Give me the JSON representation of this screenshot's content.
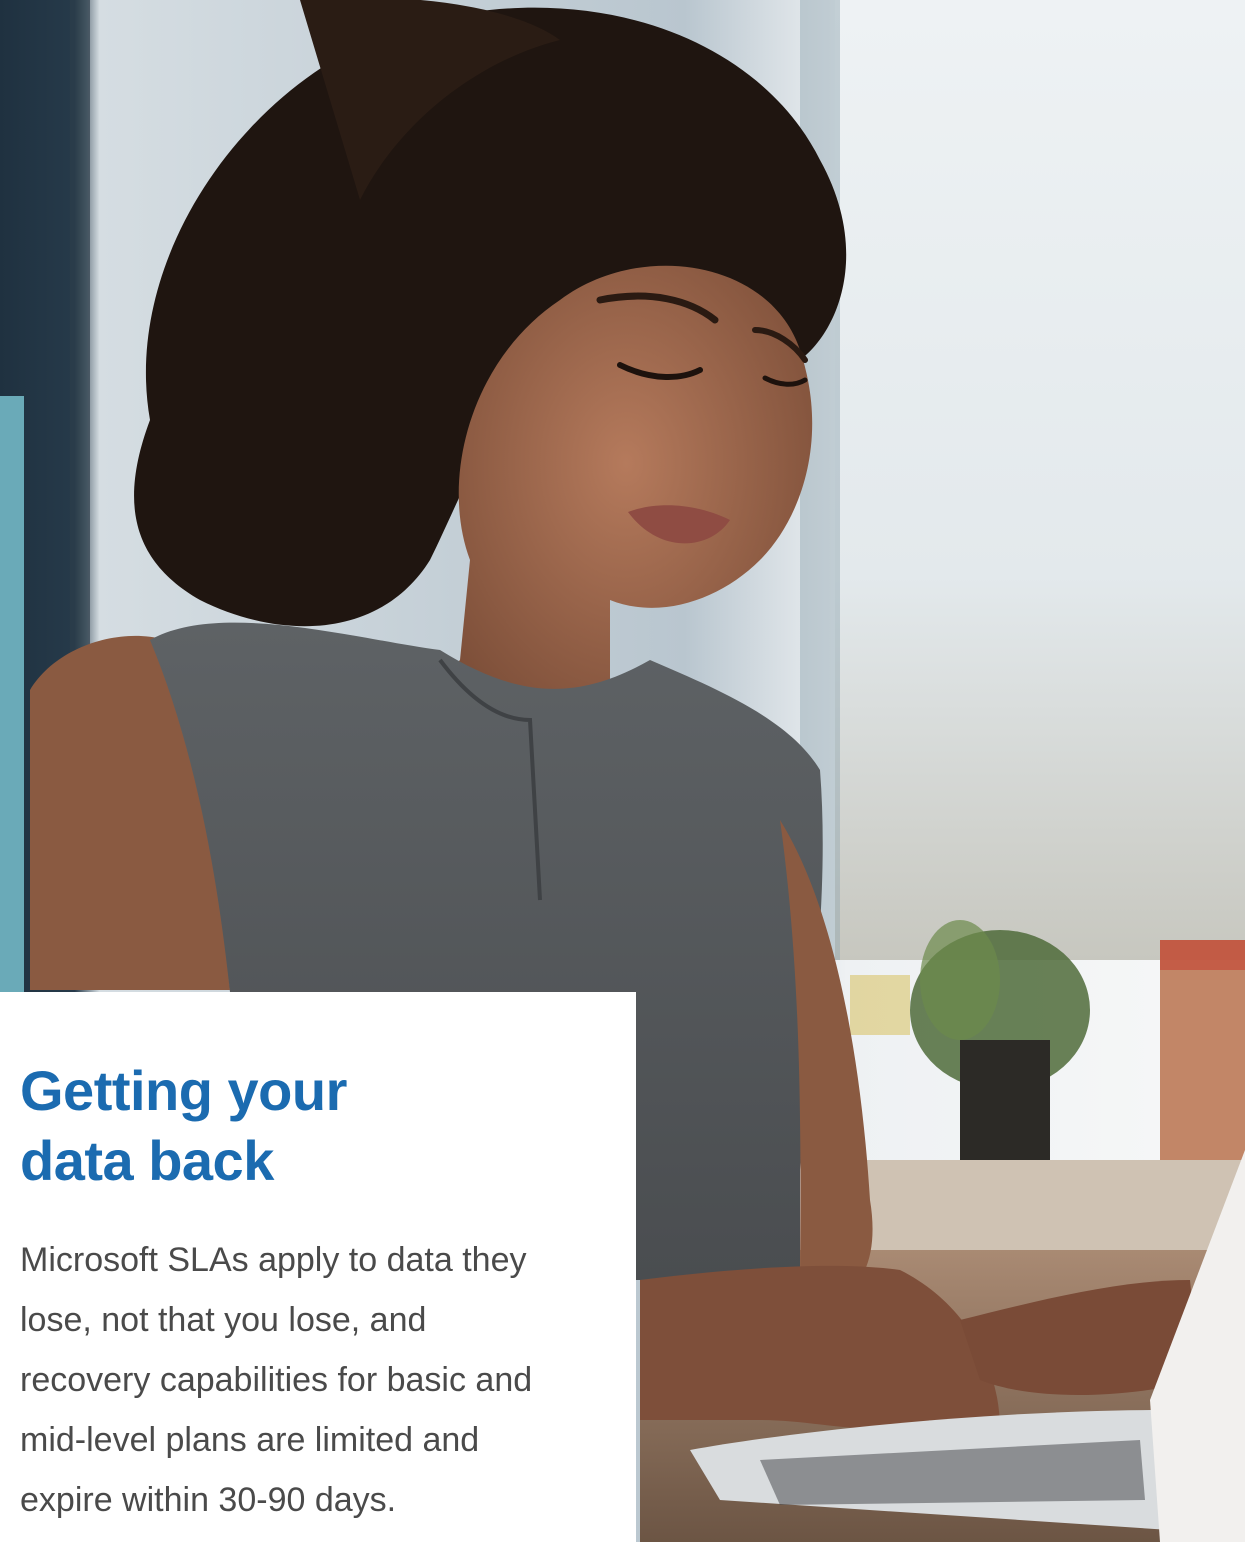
{
  "article": {
    "title": "Getting your data back",
    "body": "Microsoft SLAs apply to data they lose, not that you lose, and recovery capabilities for basic and mid-level plans are limited and expire within 30-90 days."
  },
  "colors": {
    "title": "#1b6bb0",
    "body": "#4a4a4a",
    "accent_bar": "#6aaab8",
    "card_background": "#ffffff"
  }
}
